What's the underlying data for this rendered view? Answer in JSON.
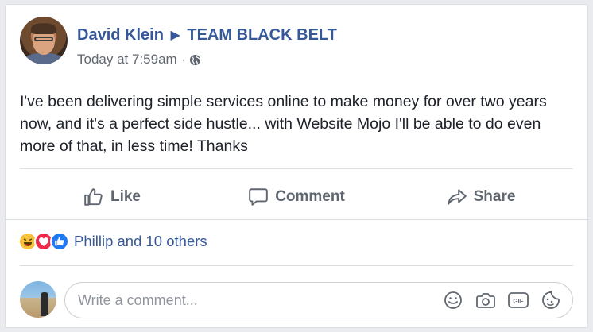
{
  "post": {
    "author": "David Klein",
    "group": "TEAM BLACK BELT",
    "timestamp": "Today at 7:59am",
    "visibility_icon": "globe-icon",
    "text": "I've been delivering simple services online to make money for over two years now, and it's a perfect side hustle... with Website Mojo I'll be able to do even more of that, in less time! Thanks"
  },
  "actions": {
    "like_label": "Like",
    "comment_label": "Comment",
    "share_label": "Share"
  },
  "reactions": {
    "icons": [
      "haha-icon",
      "love-icon",
      "like-icon"
    ],
    "summary": "Phillip and 10 others"
  },
  "comment": {
    "placeholder": "Write a comment...",
    "tools": [
      "emoji-icon",
      "camera-icon",
      "gif-icon",
      "sticker-icon"
    ]
  },
  "colors": {
    "link": "#365899",
    "muted": "#616770",
    "like_blue": "#2078f4",
    "love_red": "#f0284a",
    "haha_yellow": "#f7c23b"
  }
}
